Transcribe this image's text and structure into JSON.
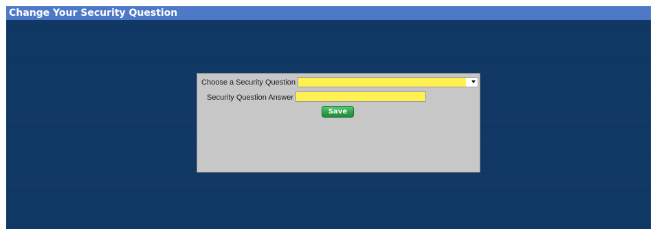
{
  "window": {
    "title": "Change Your Security Question"
  },
  "form": {
    "question_label": "Choose a Security Question",
    "question_value": "",
    "answer_label": "Security Question Answer",
    "answer_value": "",
    "save_label": "Save"
  },
  "icons": {
    "dropdown": "chevron-down-icon"
  },
  "colors": {
    "title_bar": "#4d79c7",
    "background": "#123a68",
    "panel": "#c7c7c7",
    "field_highlight": "#fff14f",
    "save_button": "#2fa24a"
  }
}
